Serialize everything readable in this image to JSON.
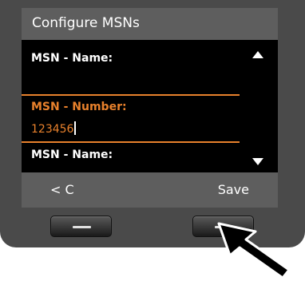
{
  "title": "Configure MSNs",
  "fields": {
    "name_label_1": "MSN - Name:",
    "number_label": "MSN - Number:",
    "number_value": "123456",
    "name_label_2": "MSN - Name:"
  },
  "softkeys": {
    "left_label": "< C",
    "right_label": "Save"
  },
  "colors": {
    "accent": "#e8812c",
    "screen_bg": "#000000",
    "bar_bg": "#5e5e5e",
    "device_bg": "#4a4a4a"
  },
  "icons": [
    "scroll-up-icon",
    "scroll-down-icon",
    "pointer-arrow-icon"
  ]
}
